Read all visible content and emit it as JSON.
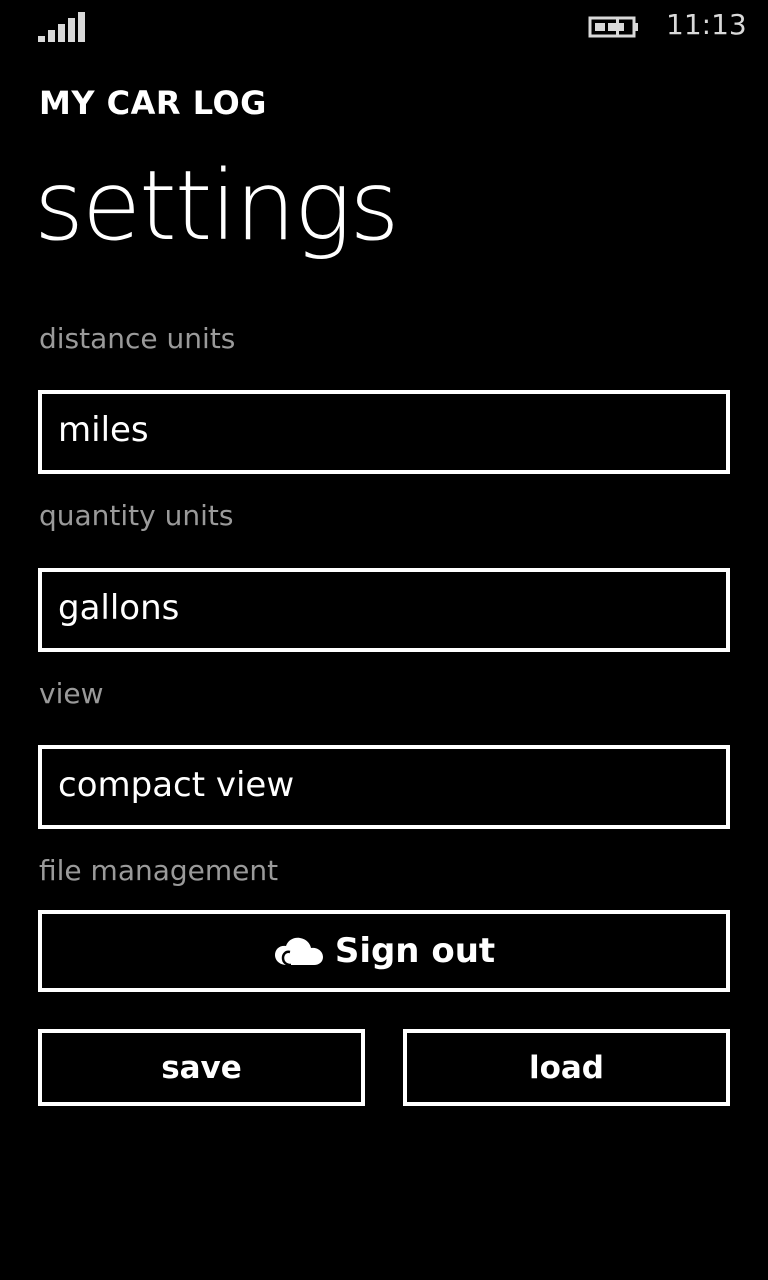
{
  "status_bar": {
    "signal_icon": "signal-strength-icon",
    "battery_icon": "battery-charging-icon",
    "time": "11:13"
  },
  "header": {
    "app_title": "MY CAR LOG",
    "page_title": "settings"
  },
  "settings": {
    "distance": {
      "label": "distance units",
      "value": "miles"
    },
    "quantity": {
      "label": "quantity units",
      "value": "gallons"
    },
    "view": {
      "label": "view",
      "value": "compact view"
    },
    "file_management": {
      "label": "file management",
      "sign_out_label": "Sign out",
      "sign_out_icon": "cloud-icon",
      "save_label": "save",
      "load_label": "load"
    }
  },
  "colors": {
    "background": "#000000",
    "foreground": "#ffffff",
    "label_gray": "#9a9a9a"
  }
}
